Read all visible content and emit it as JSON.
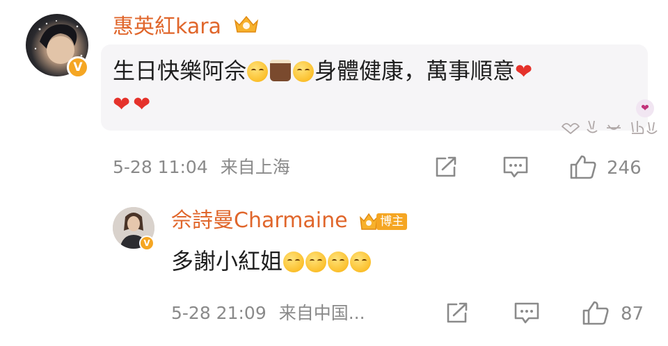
{
  "comment": {
    "author": "惠英紅kara",
    "text_before": "生日快樂阿佘",
    "text_after": "身體健康，萬事順意",
    "time": "5-28 11:04",
    "location": "来自上海",
    "likes": "246"
  },
  "reply": {
    "author": "佘詩曼Charmaine",
    "tag": "博主",
    "text": "多謝小紅姐",
    "time": "5-28 21:09",
    "location": "来自中国...",
    "likes": "87"
  },
  "badges": {
    "verified": "V"
  },
  "colors": {
    "name": "#e0662b",
    "badge": "#f5a623",
    "heart": "#e5322b",
    "meta": "#8a8a8a",
    "bubble": "#f6f5f7"
  },
  "icons": [
    "share-icon",
    "comment-icon",
    "like-icon",
    "heart-reaction-icon",
    "reaction-gestures-icon",
    "crown-icon"
  ]
}
